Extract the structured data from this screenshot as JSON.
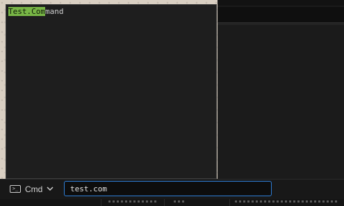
{
  "popup": {
    "suggestion": {
      "matched": "Test.Com",
      "rest": "mand"
    }
  },
  "bottom_bar": {
    "cmd_label": "Cmd",
    "terminal_icon_glyph": ">_",
    "chevron_glyph": "⌄",
    "input_value": "test.com"
  },
  "colors": {
    "accent_focus": "#2f7fd8",
    "match_highlight": "#78b646",
    "panel_bg": "#1e1e1e"
  }
}
